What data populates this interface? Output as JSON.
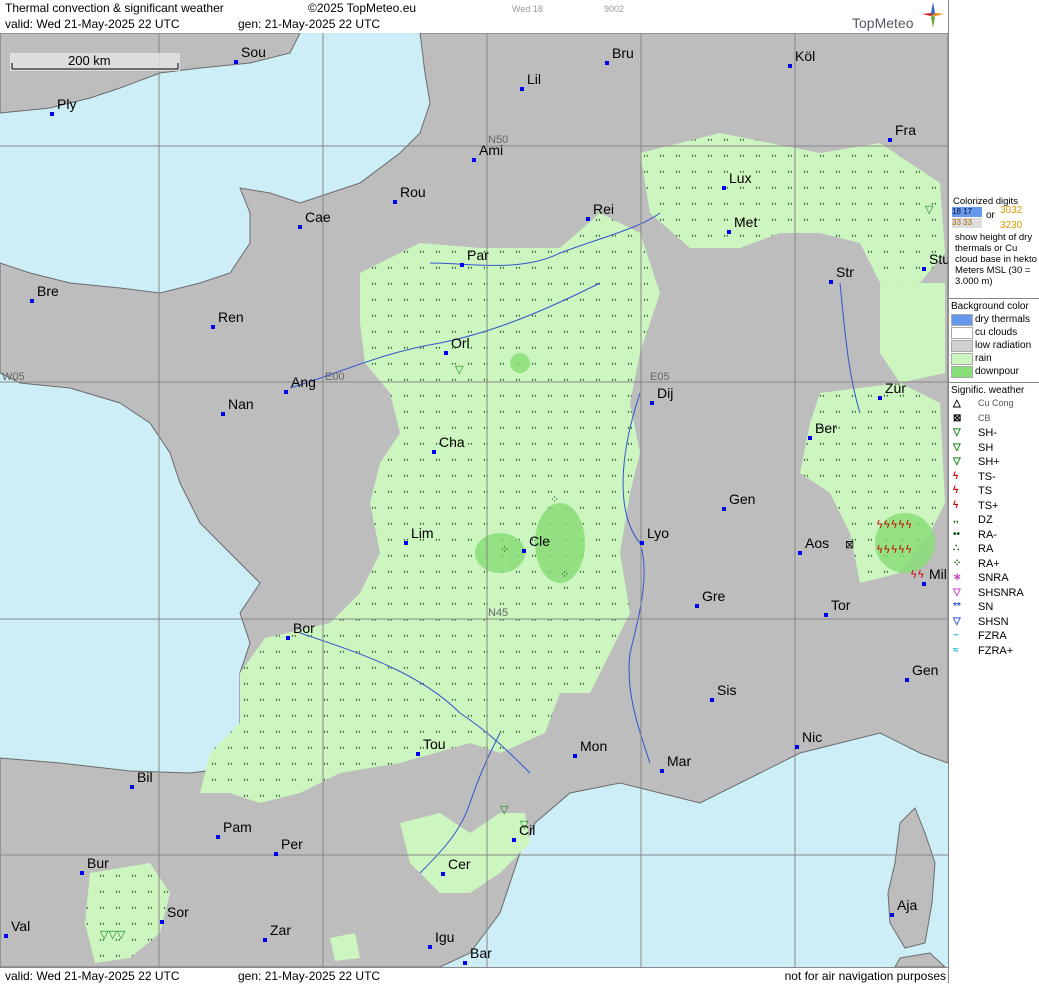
{
  "header": {
    "title": "Thermal convection & significant weather",
    "copyright": "©2025 TopMeteo.eu",
    "valid": "valid:  Wed  21-May-2025  22 UTC",
    "gen": "gen: 21-May-2025 22 UTC",
    "weekday_ref": "Wed 18",
    "code": "9002",
    "logo": "TopMeteo"
  },
  "footer": {
    "valid": "valid:  Wed  21-May-2025  22 UTC",
    "gen": "gen: 21-May-2025 22 UTC",
    "notice": "not for air navigation purposes"
  },
  "scale": {
    "label": "200 km"
  },
  "grid_labels": {
    "n50": "N50",
    "n45": "N45",
    "w05": "W05",
    "e00": "E00",
    "e05": "E05"
  },
  "cities": [
    {
      "name": "Sou"
    },
    {
      "name": "Ply"
    },
    {
      "name": "Lil"
    },
    {
      "name": "Bru"
    },
    {
      "name": "Köl"
    },
    {
      "name": "Fra"
    },
    {
      "name": "Ami"
    },
    {
      "name": "Rou"
    },
    {
      "name": "Cae"
    },
    {
      "name": "Lux"
    },
    {
      "name": "Rei"
    },
    {
      "name": "Met"
    },
    {
      "name": "Par"
    },
    {
      "name": "Bre"
    },
    {
      "name": "Str"
    },
    {
      "name": "Stu"
    },
    {
      "name": "Ren"
    },
    {
      "name": "Orl"
    },
    {
      "name": "Ang"
    },
    {
      "name": "Nan"
    },
    {
      "name": "Dij"
    },
    {
      "name": "Zür"
    },
    {
      "name": "Ber"
    },
    {
      "name": "Cha"
    },
    {
      "name": "Gen"
    },
    {
      "name": "Lim"
    },
    {
      "name": "Cle"
    },
    {
      "name": "Lyo"
    },
    {
      "name": "Aos"
    },
    {
      "name": "Mil"
    },
    {
      "name": "Gre"
    },
    {
      "name": "Tor"
    },
    {
      "name": "Bor"
    },
    {
      "name": "Gen"
    },
    {
      "name": "Sis"
    },
    {
      "name": "Nic"
    },
    {
      "name": "Tou"
    },
    {
      "name": "Mon"
    },
    {
      "name": "Mar"
    },
    {
      "name": "Bil"
    },
    {
      "name": "Pam"
    },
    {
      "name": "Per"
    },
    {
      "name": "Cil"
    },
    {
      "name": "Cer"
    },
    {
      "name": "Bur"
    },
    {
      "name": "Val"
    },
    {
      "name": "Sor"
    },
    {
      "name": "Zar"
    },
    {
      "name": "Igu"
    },
    {
      "name": "Bar"
    },
    {
      "name": "Aja"
    }
  ],
  "legend": {
    "colorized_title": "Colorized digits",
    "demo_left": "18 17",
    "demo_left2": "33 33",
    "demo_or": "or",
    "demo_right1": "3032",
    "demo_right2": "3230",
    "desc": "show height of dry thermals or Cu cloud base in hekto Meters MSL (30 = 3.000 m)",
    "background_title": "Background color",
    "background": [
      {
        "label": "dry thermals",
        "color": "#6699ee"
      },
      {
        "label": "cu clouds",
        "color": "#ffffff"
      },
      {
        "label": "low radiation",
        "color": "#d0d0d0"
      },
      {
        "label": "rain",
        "color": "#ccf5c0"
      },
      {
        "label": "downpour",
        "color": "#88dd77"
      }
    ],
    "weather_title": "Signific. weather",
    "weather": [
      {
        "label": "Cu Cong",
        "symbol": "△",
        "color": "#000000"
      },
      {
        "label": "CB",
        "symbol": "⊠",
        "color": "#000000"
      },
      {
        "label": "SH-",
        "symbol": "▽",
        "color": "#118811"
      },
      {
        "label": "SH",
        "symbol": "▽",
        "color": "#118811"
      },
      {
        "label": "SH+",
        "symbol": "▽",
        "color": "#118811"
      },
      {
        "label": "TS-",
        "symbol": "ϟ",
        "color": "#cc0000"
      },
      {
        "label": "TS",
        "symbol": "ϟ",
        "color": "#cc0000"
      },
      {
        "label": "TS+",
        "symbol": "ϟ",
        "color": "#cc0000"
      },
      {
        "label": "DZ",
        "symbol": "‚‚",
        "color": "#115511"
      },
      {
        "label": "RA-",
        "symbol": "••",
        "color": "#115511"
      },
      {
        "label": "RA",
        "symbol": "∴",
        "color": "#115511"
      },
      {
        "label": "RA+",
        "symbol": "⁘",
        "color": "#115511"
      },
      {
        "label": "SNRA",
        "symbol": "∗",
        "color": "#cc44cc"
      },
      {
        "label": "SHSNRA",
        "symbol": "▽",
        "color": "#cc44cc"
      },
      {
        "label": "SN",
        "symbol": "**",
        "color": "#3355dd"
      },
      {
        "label": "SHSN",
        "symbol": "▽",
        "color": "#3355dd"
      },
      {
        "label": "FZRA",
        "symbol": "~",
        "color": "#22bbcc"
      },
      {
        "label": "FZRA+",
        "symbol": "≈",
        "color": "#22bbcc"
      }
    ]
  }
}
